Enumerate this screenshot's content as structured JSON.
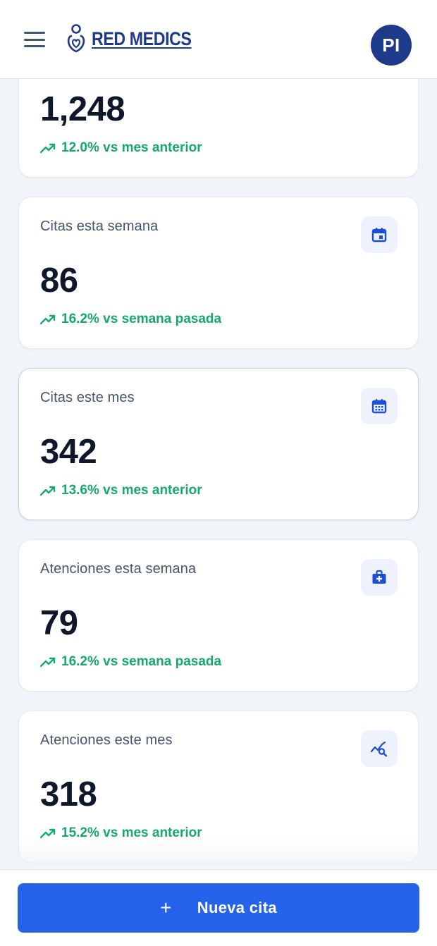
{
  "header": {
    "logo_text": "RED MEDICS",
    "avatar_initials": "PI"
  },
  "colors": {
    "brand_navy": "#1e3a8a",
    "accent_blue": "#2563eb",
    "trend_green": "#16a870",
    "icon_bg": "#edf2fd"
  },
  "stats": [
    {
      "title": "",
      "value": "1,248",
      "trend": "12.0% vs mes anterior",
      "icon": "trending-up-icon"
    },
    {
      "title": "Citas esta semana",
      "value": "86",
      "trend": "16.2% vs semana pasada",
      "icon": "calendar-day-icon"
    },
    {
      "title": "Citas este mes",
      "value": "342",
      "trend": "13.6% vs mes anterior",
      "icon": "calendar-month-icon"
    },
    {
      "title": "Atenciones esta semana",
      "value": "79",
      "trend": "16.2% vs semana pasada",
      "icon": "medical-kit-icon"
    },
    {
      "title": "Atenciones este mes",
      "value": "318",
      "trend": "15.2% vs mes anterior",
      "icon": "chart-search-icon"
    }
  ],
  "actions": {
    "new_appointment_label": "Nueva cita"
  }
}
